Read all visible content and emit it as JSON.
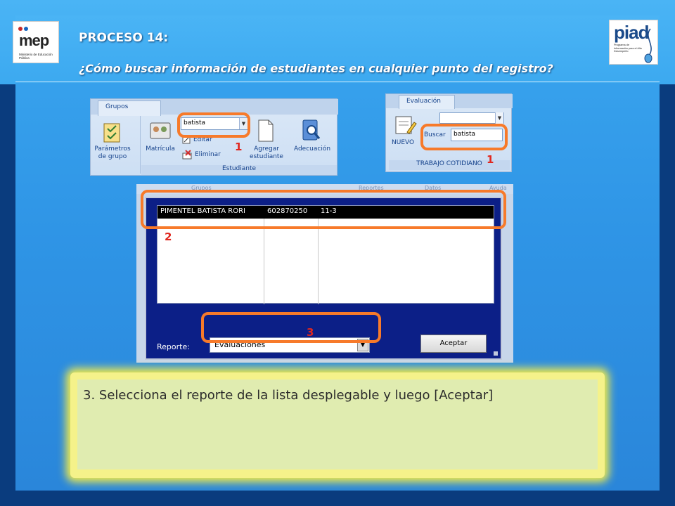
{
  "logos": {
    "mep": {
      "text": "mep",
      "subtitle": "Ministerio de Educación Pública"
    },
    "piad": {
      "text": "piad",
      "subtitle": "Programa de Información para el Alto Desempeño"
    }
  },
  "title": "PROCESO 14:",
  "subtitle": "¿Cómo  buscar información de estudiantes en cualquier punto del registro?",
  "ribbon_grupos": {
    "tab_label": "Grupos",
    "parametros_label": "Parámetros de grupo",
    "matricula_label": "Matrícula",
    "search_value": "batista",
    "editar_label": "Editar",
    "eliminar_label": "Eliminar",
    "agregar_label": "Agregar estudiante",
    "adecuacion_label": "Adecuación",
    "group_label": "Estudiante",
    "marker": "1"
  },
  "ribbon_evaluacion": {
    "tab_label": "Evaluación",
    "nuevo_label": "NUEVO",
    "buscar_label": "Buscar",
    "search_value": "batista",
    "group_label": "TRABAJO COTIDIANO",
    "marker": "1"
  },
  "dialog": {
    "topbar_items": [
      "Grupos",
      "Reportes",
      "Datos",
      "Ayuda"
    ],
    "selected_row": {
      "name": "PIMENTEL BATISTA RORI",
      "id": "602870250",
      "section": "11-3"
    },
    "list_marker": "2",
    "report_label": "Reporte:",
    "report_value": "Evaluaciones",
    "report_marker": "3",
    "accept_label": "Aceptar"
  },
  "note": {
    "text": "3. Selecciona el reporte de la lista desplegable y luego [Aceptar]"
  },
  "colors": {
    "highlight": "#f77a2a",
    "marker": "#e0271f",
    "dialog_bg": "#0c1f87",
    "note_bg": "#e0ecb0"
  }
}
